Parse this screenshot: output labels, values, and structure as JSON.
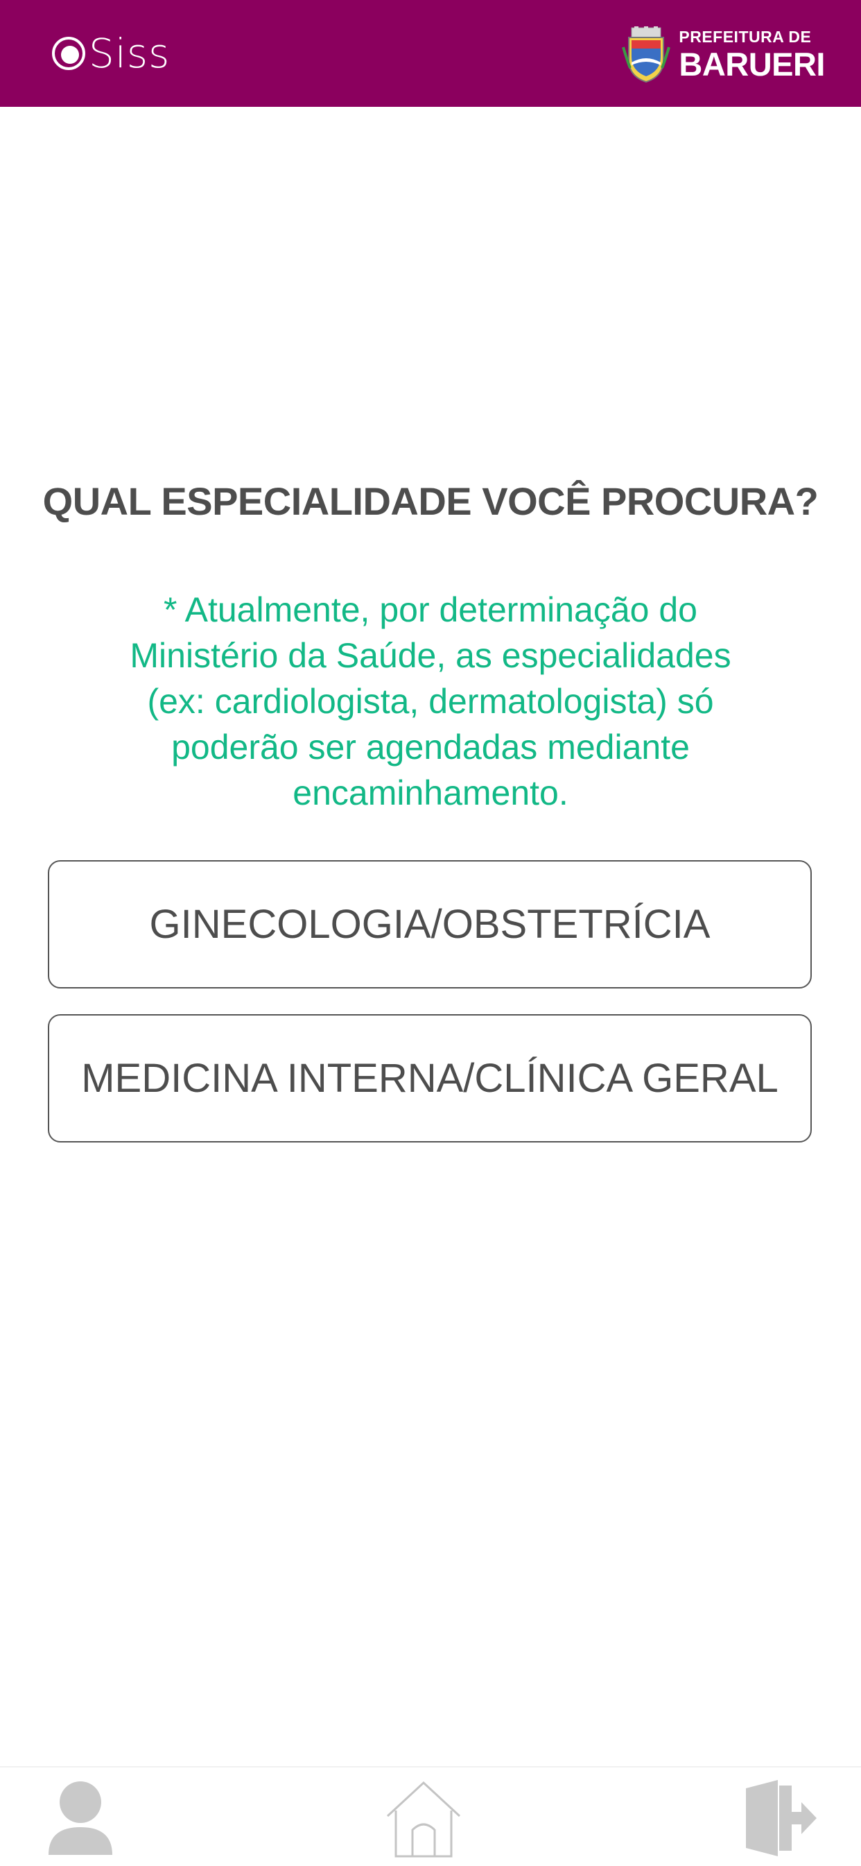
{
  "header": {
    "app_name": "Siss",
    "city_line1": "PREFEITURA DE",
    "city_line2": "BARUERI",
    "background_color": "#8b005e"
  },
  "main": {
    "question": "QUAL ESPECIALIDADE VOCÊ PROCURA?",
    "notice": "* Atualmente, por determinação do Ministério da Saúde, as especialidades (ex: cardiologista, dermatologista) só poderão ser agendadas mediante encaminhamento.",
    "notice_color": "#12b886",
    "options": [
      {
        "label": "GINECOLOGIA/OBSTETRÍCIA"
      },
      {
        "label": "MEDICINA INTERNA/CLÍNICA GERAL"
      }
    ]
  },
  "tabbar": {
    "items": [
      {
        "icon": "profile-icon"
      },
      {
        "icon": "home-icon"
      },
      {
        "icon": "exit-icon"
      }
    ]
  }
}
